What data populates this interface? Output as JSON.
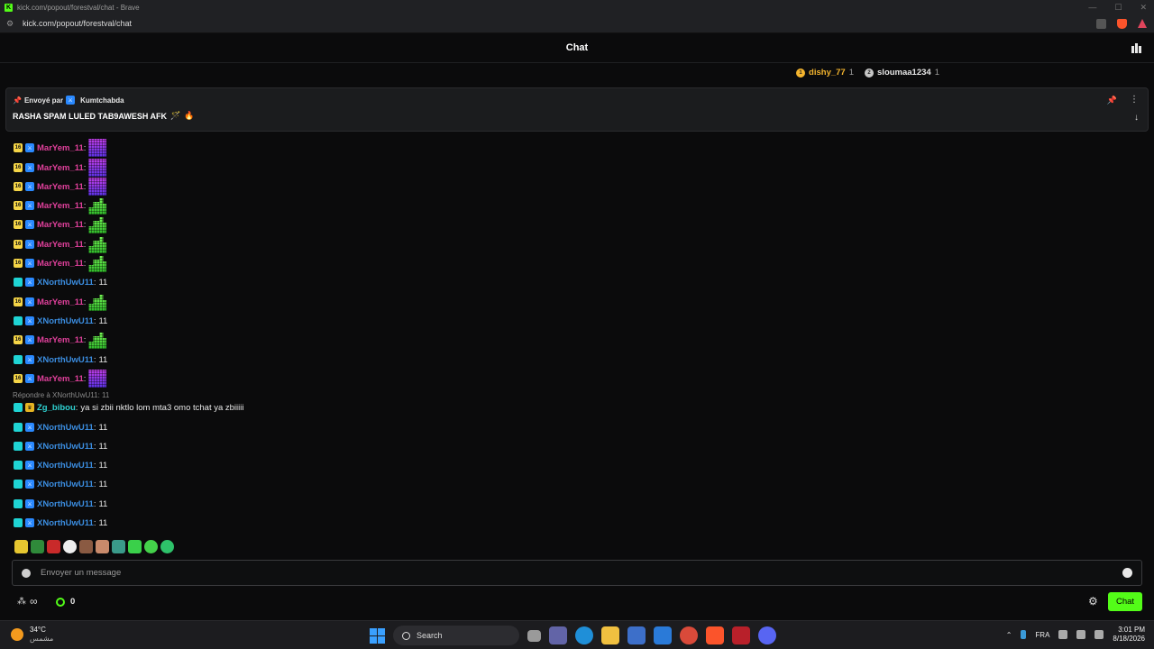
{
  "browser": {
    "window_title": "kick.com/popout/forestval/chat - Brave",
    "url": "kick.com/popout/forestval/chat"
  },
  "chat": {
    "header_title": "Chat",
    "leaders": [
      {
        "name": "dishy_77",
        "count": "1",
        "medal": "1",
        "color": "#f5b52e"
      },
      {
        "name": "sloumaa1234",
        "count": "1",
        "medal": "2",
        "color": "#e6e6e6"
      }
    ],
    "pinned": {
      "sent_by_label": "Envoyé par",
      "sender": "Kumtchabda",
      "message": "RASHA SPAM LULED TAB9AWESH AFK"
    },
    "messages": [
      {
        "user": "MarYem_11",
        "badge": "16",
        "badge_color": "yellow",
        "name_color": "pink",
        "emote": "purple"
      },
      {
        "user": "MarYem_11",
        "badge": "16",
        "badge_color": "yellow",
        "name_color": "pink",
        "emote": "purple"
      },
      {
        "user": "MarYem_11",
        "badge": "16",
        "badge_color": "yellow",
        "name_color": "pink",
        "emote": "purple"
      },
      {
        "user": "MarYem_11",
        "badge": "16",
        "badge_color": "yellow",
        "name_color": "pink",
        "emote": "green"
      },
      {
        "user": "MarYem_11",
        "badge": "16",
        "badge_color": "yellow",
        "name_color": "pink",
        "emote": "green"
      },
      {
        "user": "MarYem_11",
        "badge": "16",
        "badge_color": "yellow",
        "name_color": "pink",
        "emote": "green"
      },
      {
        "user": "MarYem_11",
        "badge": "16",
        "badge_color": "yellow",
        "name_color": "pink",
        "emote": "green"
      },
      {
        "user": "XNorthUwU11",
        "badge": "",
        "badge_color": "cyan",
        "name_color": "blue",
        "text": "11"
      },
      {
        "user": "MarYem_11",
        "badge": "16",
        "badge_color": "yellow",
        "name_color": "pink",
        "emote": "green"
      },
      {
        "user": "XNorthUwU11",
        "badge": "",
        "badge_color": "cyan",
        "name_color": "blue",
        "text": "11"
      },
      {
        "user": "MarYem_11",
        "badge": "16",
        "badge_color": "yellow",
        "name_color": "pink",
        "emote": "green"
      },
      {
        "user": "XNorthUwU11",
        "badge": "",
        "badge_color": "cyan",
        "name_color": "blue",
        "text": "11"
      },
      {
        "user": "MarYem_11",
        "badge": "16",
        "badge_color": "yellow",
        "name_color": "pink",
        "emote": "purple"
      }
    ],
    "reply_label": "Répondre à XNorthUwU11: 11",
    "reply_message": {
      "user": "Zg_bibou",
      "text": "ya si zbii nktlo lom mta3 omo tchat ya zbiiiii"
    },
    "messages_after": [
      {
        "user": "XNorthUwU11",
        "text": "11"
      },
      {
        "user": "XNorthUwU11",
        "text": "11"
      },
      {
        "user": "XNorthUwU11",
        "text": "11"
      },
      {
        "user": "XNorthUwU11",
        "text": "11"
      },
      {
        "user": "XNorthUwU11",
        "text": "11"
      },
      {
        "user": "XNorthUwU11",
        "text": "11"
      }
    ],
    "input_placeholder": "Envoyer un message",
    "points": "0",
    "chat_button": "Chat",
    "accent": "#53fc18"
  },
  "taskbar": {
    "temperature": "34°C",
    "condition": "مشمس",
    "search_label": "Search",
    "language": "FRA",
    "time": "3:01 PM",
    "date": "8/18/2026"
  }
}
